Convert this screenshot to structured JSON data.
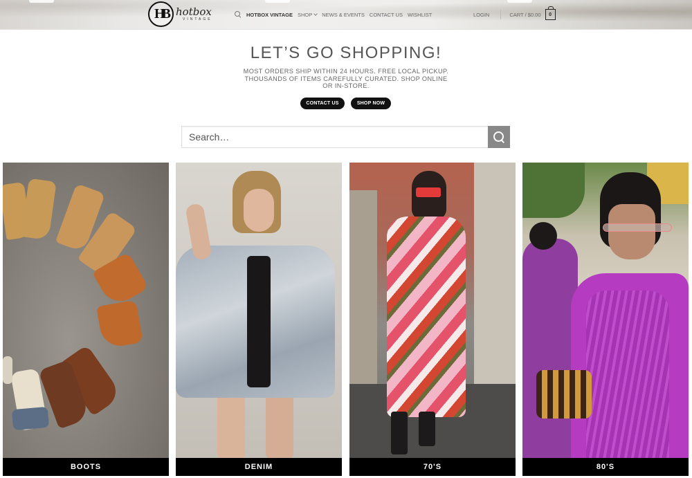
{
  "header": {
    "logo": {
      "monogram": "HB",
      "word": "hotbox",
      "sub": "VINTAGE"
    },
    "nav_left": [
      {
        "label": "HOTBOX VINTAGE"
      },
      {
        "label": "SHOP"
      },
      {
        "label": "NEWS & EVENTS"
      },
      {
        "label": "CONTACT US"
      },
      {
        "label": "WISHLIST"
      }
    ],
    "login": "LOGIN",
    "cart": {
      "label": "CART / $0.00",
      "count": "0"
    }
  },
  "hero": {
    "title": "LET’S GO SHOPPING!",
    "subtitle": "MOST ORDERS SHIP WITHIN 24 HOURS. FREE LOCAL PICKUP. THOUSANDS OF ITEMS CAREFULLY CURATED. SHOP ONLINE OR IN-STORE.",
    "buttons": {
      "contact": "CONTACT US",
      "shop": "SHOP NOW"
    }
  },
  "search": {
    "placeholder": "Search…"
  },
  "categories": [
    {
      "label": "BOOTS"
    },
    {
      "label": "DENIM"
    },
    {
      "label": "70'S"
    },
    {
      "label": "80'S"
    }
  ],
  "colors": {
    "button_bg": "#111111",
    "search_button": "#888888",
    "label_bg": "#000000"
  }
}
